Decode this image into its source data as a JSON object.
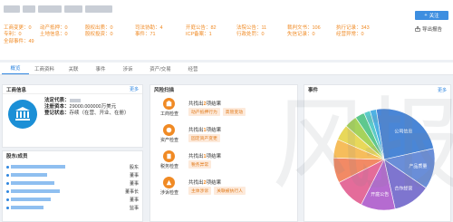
{
  "header": {
    "company_name": "██████████████████",
    "follow_label": "关注",
    "export_label": "导出报告"
  },
  "stats": {
    "row1": [
      "工商变更：0",
      "动产抵押：0",
      "股权出质：0",
      "司法协助：4",
      "开庭公告：82",
      "法院公告：11",
      "裁判文书：106",
      "执行记录：343"
    ],
    "row2": [
      "专利：0",
      "土地信息：0",
      "股权投资：0",
      "事件：71",
      "ICP备案：1",
      "行政处罚：0",
      "失信记录：0",
      "经营异常：0"
    ],
    "row3": [
      "全部事件：49"
    ]
  },
  "tabs": [
    "概览",
    "工商资料",
    "关联",
    "事件",
    "涉诉",
    "资产/交易",
    "经营"
  ],
  "company_info": {
    "title": "工商信息",
    "more": "更多",
    "legal_rep_label": "法定代表：",
    "capital_label": "注册资本：",
    "capital_value": "29000.000000万美元",
    "status_label": "登记状态：",
    "status_value": "存续（在营、开业、在册）"
  },
  "shareholders": {
    "title": "股东/成员",
    "roles": [
      "股东",
      "董事",
      "董事",
      "董事长",
      "董事",
      "监事"
    ]
  },
  "risk": {
    "title": "风险扫描",
    "items": [
      {
        "label": "工商检查",
        "prefix": "共找出",
        "count": "2",
        "suffix": "项结果",
        "tags": [
          "动产抵押行为",
          "高管变动"
        ]
      },
      {
        "label": "资产检查",
        "prefix": "共找出",
        "count": "1",
        "suffix": "项结果",
        "tags": [
          "固定资产变更"
        ]
      },
      {
        "label": "税务检查",
        "prefix": "共找出",
        "count": "1",
        "suffix": "项结果",
        "tags": [
          "税务异常"
        ]
      },
      {
        "label": "涉诉检查",
        "prefix": "共找出",
        "count": "2",
        "suffix": "项结果",
        "tags": [
          "主体涉诉",
          "关联被执行人"
        ]
      }
    ]
  },
  "events": {
    "title": "事件",
    "more": "更多",
    "slice_labels": [
      "公司信息",
      "产品质量",
      "合作经营",
      "开庭公告"
    ]
  },
  "chart_data": {
    "type": "pie",
    "categories": [
      "公司信息",
      "产品质量",
      "合作经营",
      "开庭公告",
      "",
      "",
      "",
      "",
      "",
      "",
      "",
      ""
    ],
    "values": [
      24,
      13,
      12,
      11,
      10,
      8,
      6,
      5,
      4,
      3,
      2,
      2
    ],
    "colors": [
      "#4a86d6",
      "#6a8ed8",
      "#7e75cf",
      "#b56bd0",
      "#e46c9a",
      "#f28a65",
      "#f6bd5c",
      "#e8d85a",
      "#a6d35c",
      "#5fc88e",
      "#5ccbc9",
      "#4fb1e3"
    ]
  },
  "watermark": "风报"
}
